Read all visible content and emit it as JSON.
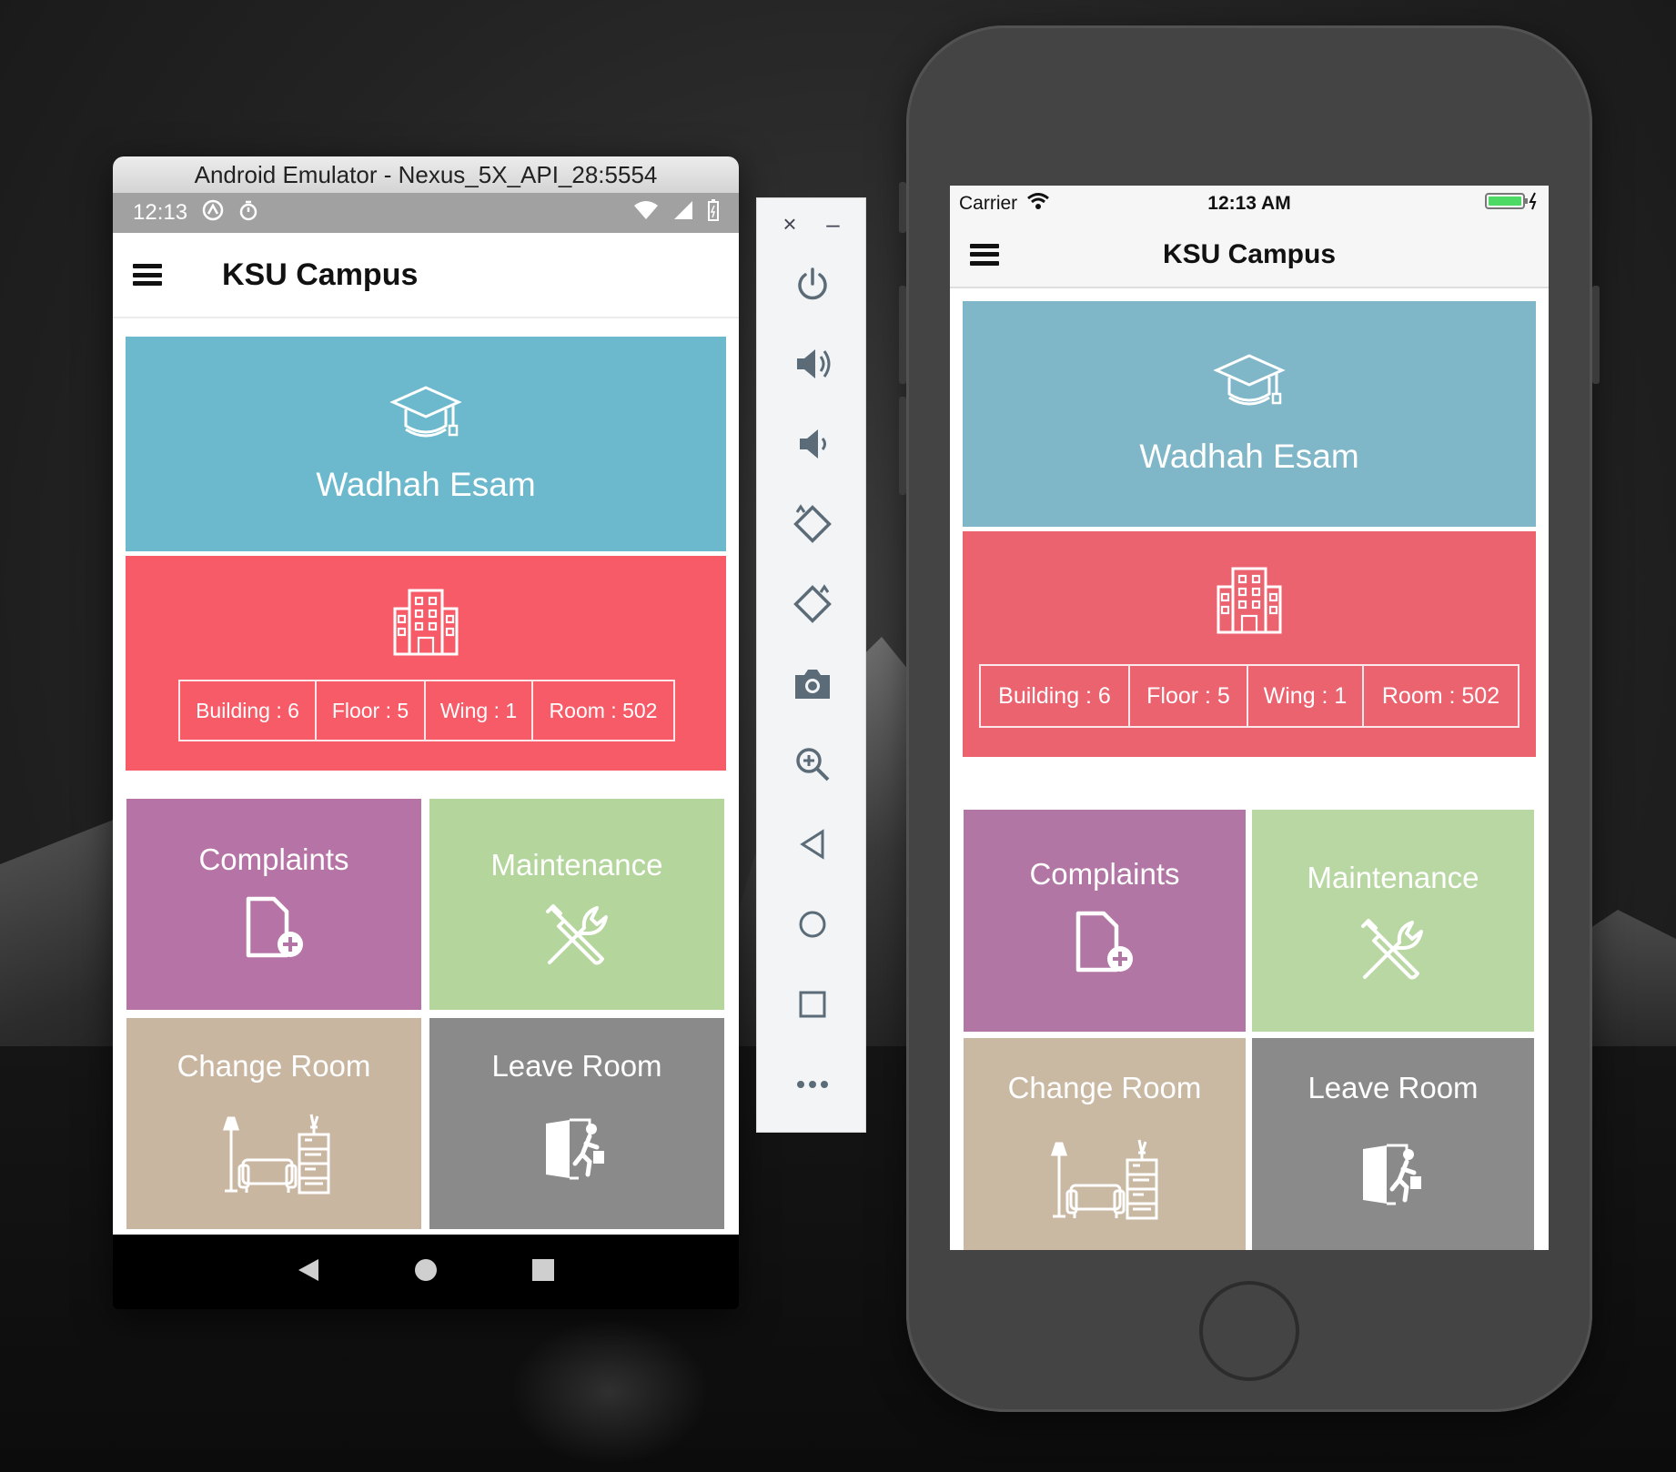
{
  "android": {
    "window_title": "Android Emulator - Nexus_5X_API_28:5554",
    "status_time": "12:13",
    "app_title": "KSU Campus",
    "profile": {
      "name": "Wadhah Esam"
    },
    "info": [
      "Building : 6",
      "Floor : 5",
      "Wing : 1",
      "Room : 502"
    ],
    "tiles": {
      "complaints": "Complaints",
      "maintenance": "Maintenance",
      "change_room": "Change Room",
      "leave_room": "Leave Room"
    }
  },
  "emulator_toolbar": {
    "close": "×",
    "minimize": "–",
    "buttons": [
      "power-icon",
      "volume-up-icon",
      "volume-down-icon",
      "rotate-left-icon",
      "rotate-right-icon",
      "camera-icon",
      "zoom-icon",
      "back-icon",
      "home-icon",
      "overview-icon",
      "more-icon"
    ]
  },
  "ios": {
    "carrier": "Carrier",
    "status_time": "12:13 AM",
    "app_title": "KSU Campus",
    "profile": {
      "name": "Wadhah Esam"
    },
    "info": [
      "Building : 6",
      "Floor : 5",
      "Wing : 1",
      "Room : 502"
    ],
    "tiles": {
      "complaints": "Complaints",
      "maintenance": "Maintenance",
      "change_room": "Change Room",
      "leave_room": "Leave Room"
    }
  },
  "colors": {
    "android_profile": "#6cb8cc",
    "android_building": "#f75b67",
    "android_complaints": "#b674a6",
    "android_maintenance": "#b4d59c",
    "android_change_room": "#c9b6a0",
    "android_leave_room": "#8a8a8a",
    "ios_profile": "#7fb6c8",
    "ios_building": "#ec6370",
    "ios_complaints": "#b276a4",
    "ios_maintenance": "#b9d7a2",
    "ios_change_room": "#c9b8a2",
    "ios_leave_room": "#8a8a8a"
  }
}
